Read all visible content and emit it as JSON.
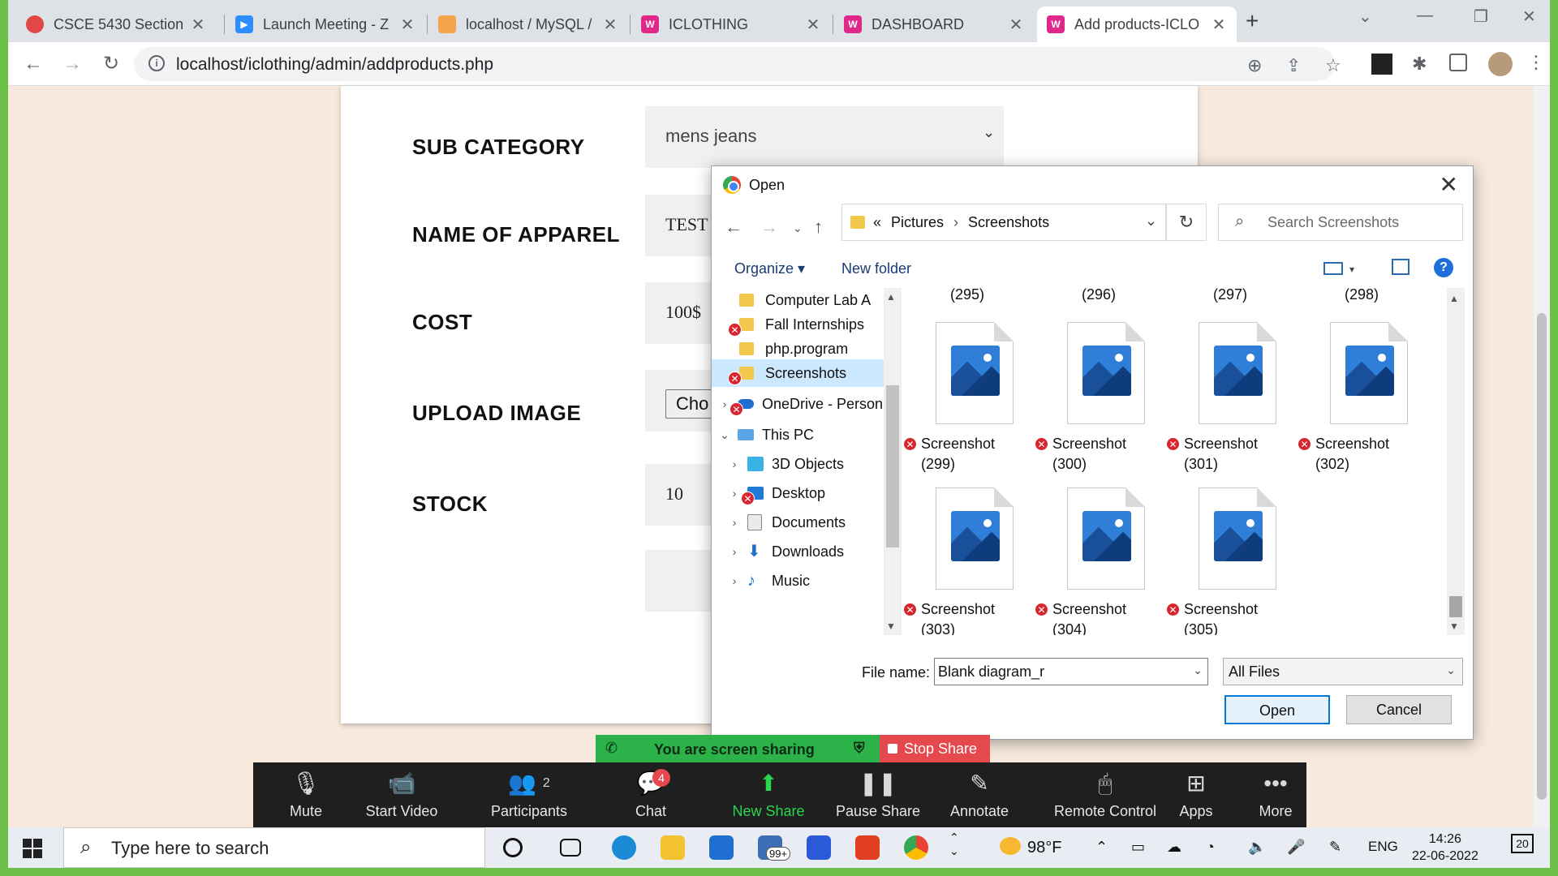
{
  "browser": {
    "tabs": [
      {
        "title": "CSCE 5430 Section",
        "icon_color": "#e04848",
        "active": false
      },
      {
        "title": "Launch Meeting - Z",
        "icon_color": "#2d8cff",
        "active": false
      },
      {
        "title": "localhost / MySQL /",
        "icon_color": "#f4a24b",
        "active": false
      },
      {
        "title": "ICLOTHING",
        "icon_color": "#e0278a",
        "active": false
      },
      {
        "title": "DASHBOARD",
        "icon_color": "#e0278a",
        "active": false
      },
      {
        "title": "Add products-ICLO",
        "icon_color": "#e0278a",
        "active": true
      }
    ],
    "url": "localhost/iclothing/admin/addproducts.php"
  },
  "form": {
    "sub_category_label": "SUB CATEGORY",
    "sub_category_value": "mens jeans",
    "apparel_label": "NAME OF APPAREL",
    "apparel_value": "TEST",
    "cost_label": "COST",
    "cost_value": "100$",
    "upload_label": "UPLOAD IMAGE",
    "choose_label": "Cho",
    "stock_label": "STOCK",
    "stock_value": "10"
  },
  "dialog": {
    "title": "Open",
    "breadcrumb": [
      "«",
      "Pictures",
      "Screenshots"
    ],
    "search_placeholder": "Search Screenshots",
    "organize": "Organize",
    "new_folder": "New folder",
    "help": "?",
    "tree": [
      {
        "label": "Computer Lab A",
        "error": false,
        "selected": false,
        "expander": ""
      },
      {
        "label": "Fall Internships",
        "error": true,
        "selected": false,
        "expander": ""
      },
      {
        "label": "php.program",
        "error": false,
        "selected": false,
        "expander": ""
      },
      {
        "label": "Screenshots",
        "error": true,
        "selected": true,
        "expander": ""
      },
      {
        "label": "OneDrive - Person",
        "error": true,
        "selected": false,
        "expander": "›"
      },
      {
        "label": "This PC",
        "error": false,
        "selected": false,
        "expander": "⌄"
      },
      {
        "label": "3D Objects",
        "error": false,
        "selected": false,
        "expander": "›"
      },
      {
        "label": "Desktop",
        "error": true,
        "selected": false,
        "expander": "›"
      },
      {
        "label": "Documents",
        "error": false,
        "selected": false,
        "expander": "›"
      },
      {
        "label": "Downloads",
        "error": false,
        "selected": false,
        "expander": "›"
      },
      {
        "label": "Music",
        "error": false,
        "selected": false,
        "expander": "›"
      }
    ],
    "top_row_labels": [
      "(295)",
      "(296)",
      "(297)",
      "(298)"
    ],
    "files": [
      {
        "name": "Screenshot",
        "num": "(299)"
      },
      {
        "name": "Screenshot",
        "num": "(300)"
      },
      {
        "name": "Screenshot",
        "num": "(301)"
      },
      {
        "name": "Screenshot",
        "num": "(302)"
      },
      {
        "name": "Screenshot",
        "num": "(303)"
      },
      {
        "name": "Screenshot",
        "num": "(304)"
      },
      {
        "name": "Screenshot",
        "num": "(305)"
      }
    ],
    "file_name_label": "File name:",
    "file_name_value": "Blank diagram_r",
    "file_type": "All Files",
    "open_button": "Open",
    "cancel_button": "Cancel"
  },
  "zoom": {
    "sharing_text": "You are screen sharing",
    "stop_share": "Stop Share",
    "items": [
      {
        "label": "Mute",
        "icon": "microphone-icon"
      },
      {
        "label": "Start Video",
        "icon": "video-off-icon"
      },
      {
        "label": "Participants",
        "icon": "participants-icon"
      },
      {
        "label": "Chat",
        "icon": "chat-icon"
      },
      {
        "label": "New Share",
        "icon": "share-icon"
      },
      {
        "label": "Pause Share",
        "icon": "pause-icon"
      },
      {
        "label": "Annotate",
        "icon": "pencil-icon"
      },
      {
        "label": "Remote Control",
        "icon": "mouse-icon"
      },
      {
        "label": "Apps",
        "icon": "apps-icon"
      },
      {
        "label": "More",
        "icon": "more-icon"
      }
    ],
    "participants_count": "2",
    "chat_badge": "4"
  },
  "taskbar": {
    "search_placeholder": "Type here to search",
    "mail_badge": "99+",
    "temperature": "98°F",
    "language": "ENG",
    "time": "14:26",
    "date": "22-06-2022",
    "notification_count": "20"
  }
}
